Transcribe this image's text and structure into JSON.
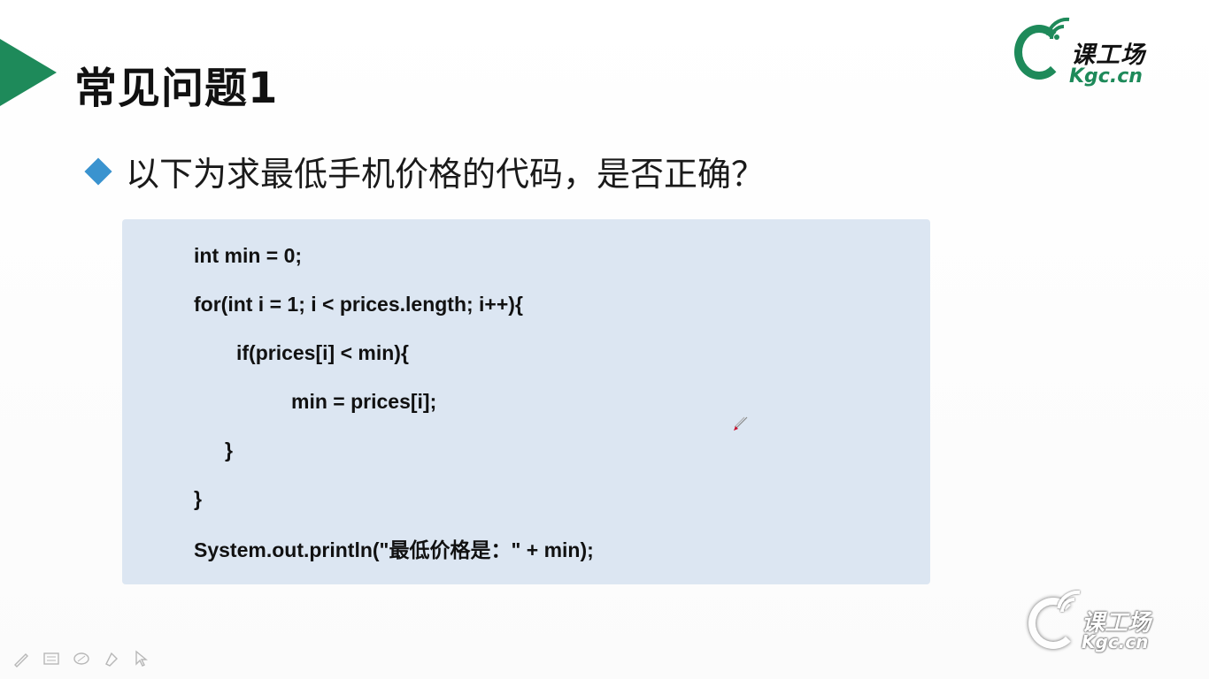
{
  "slide": {
    "title": "常见问题1",
    "question": "以下为求最低手机价格的代码，是否正确？"
  },
  "code": {
    "lines": [
      "int min = 0;",
      "for(int i = 1; i < prices.length; i++){",
      "if(prices[i] < min){",
      "min = prices[i];",
      "}",
      "}",
      "System.out.println(\"最低价格是：\" + min);"
    ]
  },
  "logo": {
    "cn": "课工场",
    "en": "Kgc.cn"
  },
  "watermark": {
    "cn": "课工场",
    "en": "Kgc.cn"
  },
  "colors": {
    "accent_green": "#1e8a5a",
    "bullet_blue": "#3a93cf",
    "code_bg": "#dce6f2"
  },
  "toolbar": {
    "icons": [
      "pen-icon",
      "slides-icon",
      "eraser-icon",
      "highlighter-icon",
      "pointer-icon"
    ]
  }
}
